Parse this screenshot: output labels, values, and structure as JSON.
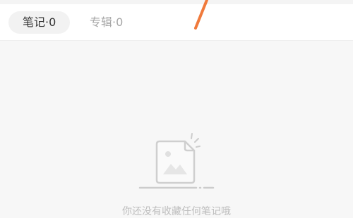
{
  "tabs": [
    {
      "label": "笔记·0",
      "active": true
    },
    {
      "label": "专辑·0",
      "active": false
    }
  ],
  "empty_state": {
    "icon": "empty-document-image-icon",
    "text": "你还没有收藏任何笔记哦"
  },
  "colors": {
    "accent_stroke": "#f07a3c",
    "active_tab_bg": "#f2f2f2",
    "inactive_tab_text": "#a6a6a6"
  }
}
